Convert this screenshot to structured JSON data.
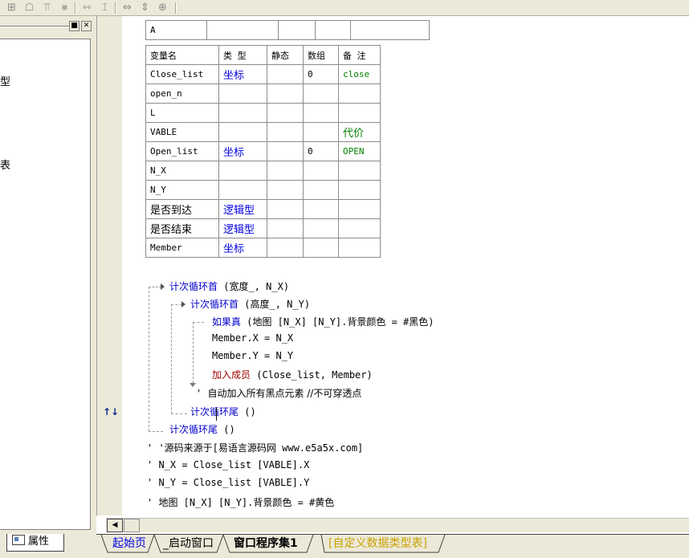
{
  "toolbar": {
    "icons": [
      "grid-icon",
      "align-icon",
      "align-top-icon",
      "distribute-icon",
      "h-spacing-icon",
      "v-spacing-icon",
      "width-icon",
      "height-icon",
      "center-icon"
    ]
  },
  "left_panel": {
    "fragments": [
      "型",
      "表"
    ],
    "properties_tab": "属性"
  },
  "table_a": {
    "rows": [
      [
        "A",
        "",
        "",
        "",
        ""
      ]
    ]
  },
  "variables": {
    "headers": [
      "变量名",
      "类 型",
      "静态",
      "数组",
      "备 注"
    ],
    "rows": [
      [
        "Close_list",
        "坐标",
        "",
        "0",
        "close"
      ],
      [
        "open_n",
        "",
        "",
        "",
        ""
      ],
      [
        "L",
        "",
        "",
        "",
        ""
      ],
      [
        "VABLE",
        "",
        "",
        "",
        "代价"
      ],
      [
        "Open_list",
        "坐标",
        "",
        "0",
        "OPEN"
      ],
      [
        "N_X",
        "",
        "",
        "",
        ""
      ],
      [
        "N_Y",
        "",
        "",
        "",
        ""
      ],
      [
        "是否到达",
        "逻辑型",
        "",
        "",
        ""
      ],
      [
        "是否结束",
        "逻辑型",
        "",
        "",
        ""
      ],
      [
        "Member",
        "坐标",
        "",
        "",
        ""
      ]
    ]
  },
  "code": {
    "l1_kw": "计次循环首",
    "l1_args": " (宽度_, N_X)",
    "l2_kw": "计次循环首",
    "l2_args": " (高度_, N_Y)",
    "l3_kw": "如果真",
    "l3_args": " (地图 [N_X] [N_Y].背景颜色 = #黑色)",
    "l4": "Member.X = N_X",
    "l5": "Member.Y = N_Y",
    "l6_kw": "加入成员",
    "l6_args": " (Close_list, Member)",
    "l7_comment": "自动加入所有黑点元素 //不可穿透点",
    "l8_kw": "计次循环尾",
    "l8_args": " ()",
    "l9_kw": "计次循环尾",
    "l9_args": " ()",
    "c1": "' '源码来源于[易语言源码网 www.e5a5x.com]",
    "c2": "' N_X = Close_list [VABLE].X",
    "c3": "' N_Y = Close_list [VABLE].Y",
    "c4": "' 地图 [N_X] [N_Y].背景颜色 = #黄色"
  },
  "tabs": [
    "起始页",
    "_启动窗口",
    "窗口程序集1",
    "[自定义数据类型表]"
  ],
  "colors": {
    "keyword": "#0000cc",
    "type_blue": "#0000e0",
    "comment_green": "#008000",
    "add_member_red": "#a00000",
    "panel_bg": "#ece9d8"
  }
}
